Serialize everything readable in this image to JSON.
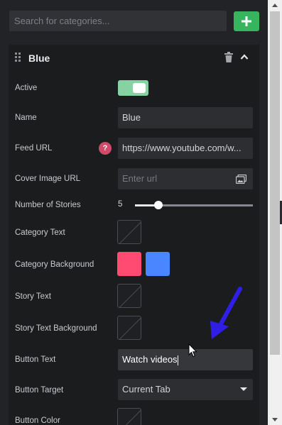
{
  "search": {
    "placeholder": "Search for categories..."
  },
  "add_button": {
    "label": "+"
  },
  "category": {
    "title": "Blue",
    "fields": {
      "active_label": "Active",
      "active_value": true,
      "name_label": "Name",
      "name_value": "Blue",
      "feed_url_label": "Feed URL",
      "feed_url_help": "?",
      "feed_url_value": "https://www.youtube.com/w...",
      "cover_image_label": "Cover Image URL",
      "cover_image_placeholder": "Enter url",
      "stories_label": "Number of Stories",
      "stories_value": "5",
      "stories_fraction": 0.2,
      "category_text_label": "Category Text",
      "category_bg_label": "Category Background",
      "category_bg_colors": [
        "#ff4a72",
        "#4a86ff"
      ],
      "story_text_label": "Story Text",
      "story_text_bg_label": "Story Text Background",
      "button_text_label": "Button Text",
      "button_text_value": "Watch videos",
      "button_target_label": "Button Target",
      "button_target_value": "Current Tab",
      "button_color_label": "Button Color"
    }
  },
  "colors": {
    "accent_green": "#37b55e",
    "toggle_on": "#86d2a3",
    "annotation_arrow": "#2f1ee6"
  }
}
